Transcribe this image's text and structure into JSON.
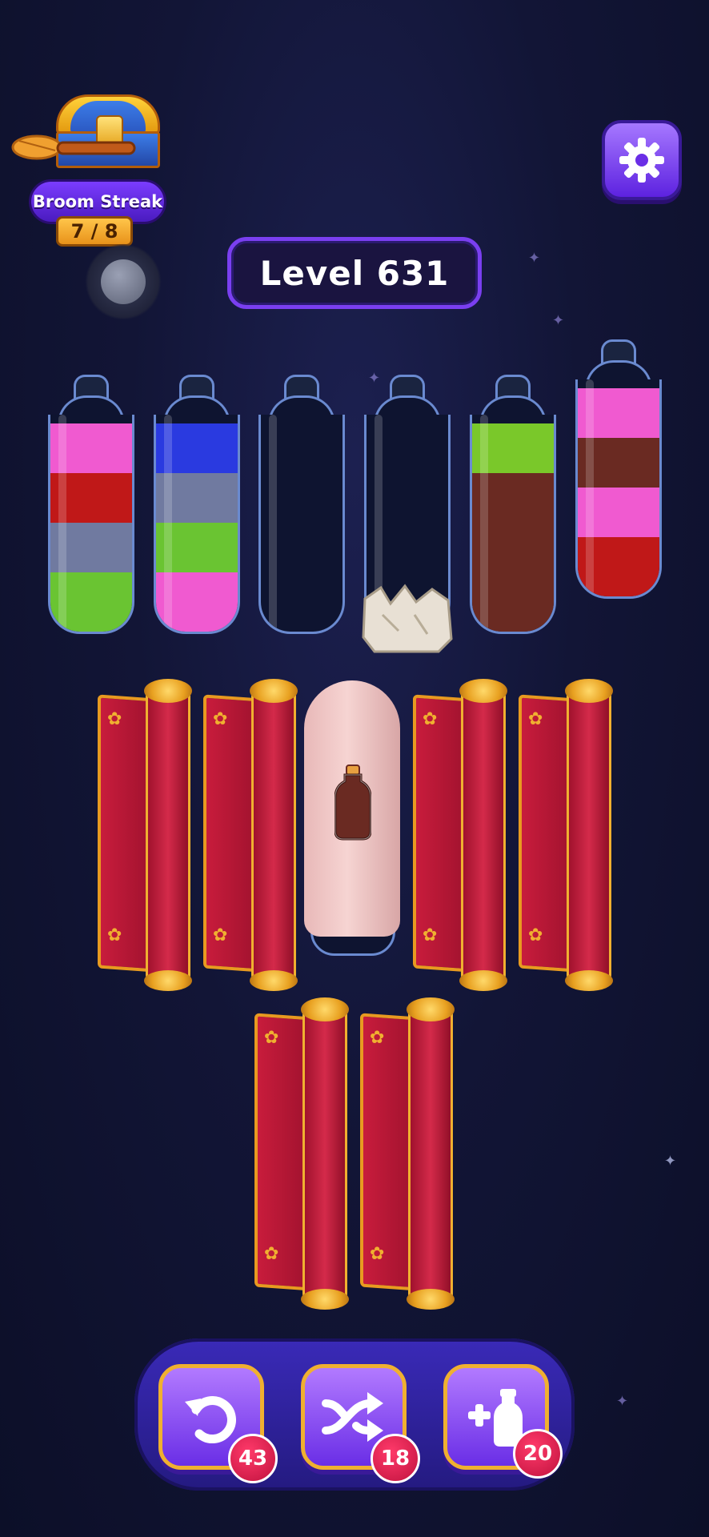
{
  "streak": {
    "label": "Broom Streak",
    "count": "7 / 8"
  },
  "level": {
    "label": "Level 631"
  },
  "icons": {
    "settings": "gear-icon",
    "undo": "undo-icon",
    "shuffle": "shuffle-icon",
    "add_bottle": "add-bottle-icon"
  },
  "bottles": [
    {
      "layers": [
        "#f05ad0",
        "#c01818",
        "#707aa0",
        "#6ac432"
      ]
    },
    {
      "layers": [
        "#2a3ae0",
        "#707aa0",
        "#6ac432",
        "#f05ad0"
      ]
    },
    {
      "layers": []
    },
    {
      "layers": [],
      "blocked_by": "rocks"
    },
    {
      "layers": [
        "#7ac82a",
        "#6a2a22",
        "#6a2a22",
        "#6a2a22"
      ]
    },
    {
      "layers": [
        "#f05ad0",
        "#6a2a22",
        "#f05ad0",
        "#c01818"
      ]
    }
  ],
  "toolbar": {
    "undo_count": "43",
    "shuffle_count": "18",
    "add_bottle_count": "20"
  },
  "colors": {
    "accent": "#7a3ff0",
    "gold": "#f0b030",
    "curtain": "#c81c3c"
  }
}
